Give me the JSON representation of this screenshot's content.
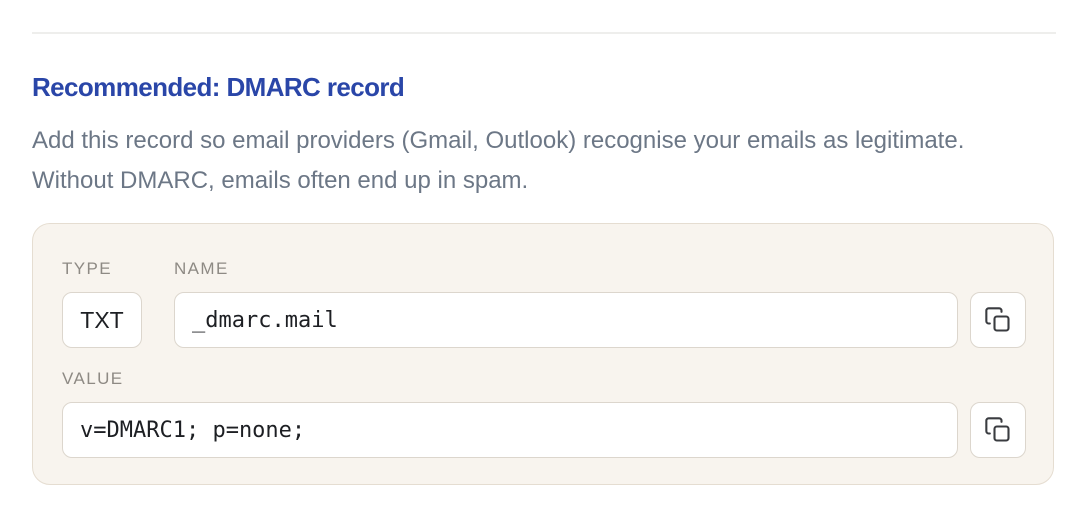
{
  "section": {
    "title": "Recommended: DMARC record",
    "description": "Add this record so email providers (Gmail, Outlook) recognise your emails as legitimate. Without DMARC, emails often end up in spam."
  },
  "record": {
    "type_label": "TYPE",
    "name_label": "NAME",
    "value_label": "VALUE",
    "type": "TXT",
    "name": "_dmarc.mail",
    "value": "v=DMARC1; p=none;"
  },
  "icons": {
    "copy": "copy-icon"
  },
  "colors": {
    "title": "#2a46a8",
    "description": "#6c7786",
    "card_background": "#f8f4ee",
    "card_border": "#e5ddd1"
  }
}
